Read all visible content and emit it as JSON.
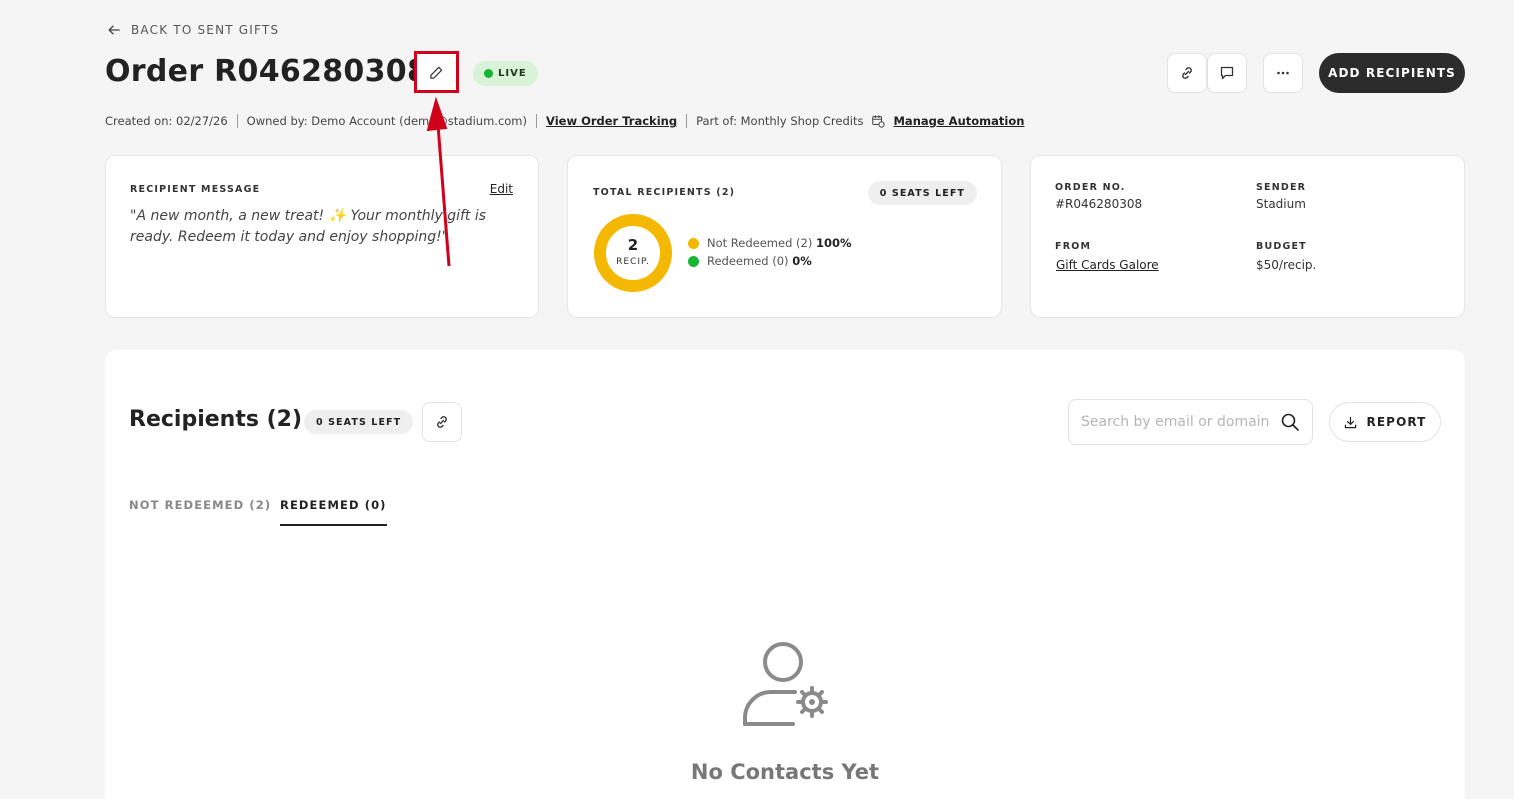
{
  "header": {
    "back_label": "BACK TO SENT GIFTS",
    "order_title": "Order R046280308",
    "status": "LIVE",
    "add_recipients_label": "ADD RECIPIENTS"
  },
  "meta": {
    "created": "Created on: 02/27/26",
    "owned_by": "Owned by: Demo Account (demo@stadium.com)",
    "view_tracking": "View Order Tracking",
    "part_of": "Part of: Monthly Shop Credits",
    "manage_automation": "Manage Automation"
  },
  "message_card": {
    "label": "RECIPIENT MESSAGE",
    "edit_label": "Edit",
    "text": "\"A new month, a new treat! ✨ Your monthly gift is ready. Redeem it today and enjoy shopping!\""
  },
  "recipients_card": {
    "label": "TOTAL RECIPIENTS (2)",
    "seats_left": "0 SEATS LEFT",
    "donut_count": "2",
    "donut_unit": "RECIP.",
    "legend": [
      {
        "label": "Not Redeemed (2)",
        "percent": "100%",
        "color": "#f5b800"
      },
      {
        "label": "Redeemed (0)",
        "percent": "0%",
        "color": "#19b536"
      }
    ],
    "chart_data": {
      "type": "pie",
      "categories": [
        "Not Redeemed",
        "Redeemed"
      ],
      "values": [
        2,
        0
      ]
    }
  },
  "info_card": {
    "order_no_label": "ORDER NO.",
    "order_no": "#R046280308",
    "sender_label": "SENDER",
    "sender": "Stadium",
    "from_label": "FROM",
    "from": "Gift Cards Galore",
    "budget_label": "BUDGET",
    "budget": "$50/recip."
  },
  "recipients_section": {
    "title": "Recipients (2)",
    "seats_left": "0 SEATS LEFT",
    "search_placeholder": "Search by email or domain",
    "report_label": "REPORT",
    "tabs": [
      {
        "label": "NOT REDEEMED (2)",
        "active": false
      },
      {
        "label": "REDEEMED (0)",
        "active": true
      }
    ],
    "empty_text": "No Contacts Yet"
  },
  "colors": {
    "accent_dark": "#2c2c2c",
    "highlight_red": "#d0021b",
    "live_green": "#15b336",
    "donut_yellow": "#f5b800"
  }
}
